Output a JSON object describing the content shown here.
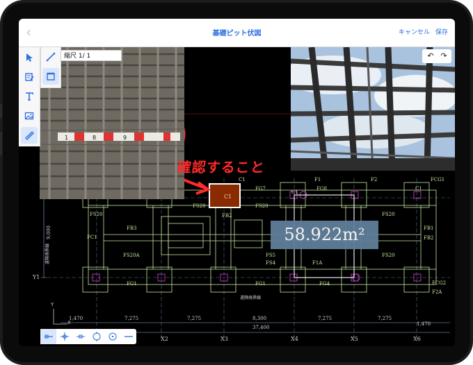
{
  "nav": {
    "title": "基礎ピット伏図",
    "cancel": "キャンセル",
    "save": "保存"
  },
  "toolbar": {
    "tools": [
      "select-arrow-icon",
      "edit-note-icon",
      "text-tool-icon",
      "image-tool-icon",
      "measure-ruler-icon"
    ],
    "active": "measure-ruler-icon"
  },
  "scale": {
    "label": "縮尺 1/ 1"
  },
  "annotation": {
    "text": "確認すること",
    "color": "#ff2a2a"
  },
  "measurement": {
    "value": "58.922m²"
  },
  "snapbar": {
    "modes": [
      "snap-endpoint-icon",
      "snap-intersection-icon",
      "snap-midpoint-icon",
      "snap-circle-icon",
      "snap-center-icon",
      "snap-line-icon"
    ],
    "active": "snap-endpoint-icon"
  },
  "drawing": {
    "grid_x": [
      "X2",
      "X3",
      "X4",
      "X5",
      "X6"
    ],
    "grid_y": [
      "Y1"
    ],
    "dimensions": [
      "1,470",
      "7,275",
      "7,275",
      "8,300",
      "7,275",
      "7,275",
      "1,470"
    ],
    "total_dimension": "37,400",
    "members_top": [
      "C1",
      "FG7",
      "C1",
      "F1",
      "FG8",
      "F2",
      "C1",
      "FCG1"
    ],
    "members": [
      "FS20",
      "FB3",
      "FB2",
      "FS20A",
      "FG1",
      "FG4",
      "FG1",
      "F2A",
      "FB2",
      "FB1",
      "FCG2",
      "FS5",
      "FS4",
      "FC1",
      "F1A",
      "FS20",
      "FS20",
      "FS20",
      "FS20"
    ],
    "highlight_member": "C1",
    "side_labels": [
      "9,000",
      "遠隔境界線"
    ],
    "bottom_label": "遠隔境界線",
    "axis_labels": [
      "Y",
      "X"
    ]
  },
  "colors": {
    "accent": "#2c6fe0",
    "cad_line": "#c7e8a0",
    "cad_grid": "#6a84a5",
    "annotation": "#ff2a2a",
    "highlight": "#8a2a00"
  }
}
